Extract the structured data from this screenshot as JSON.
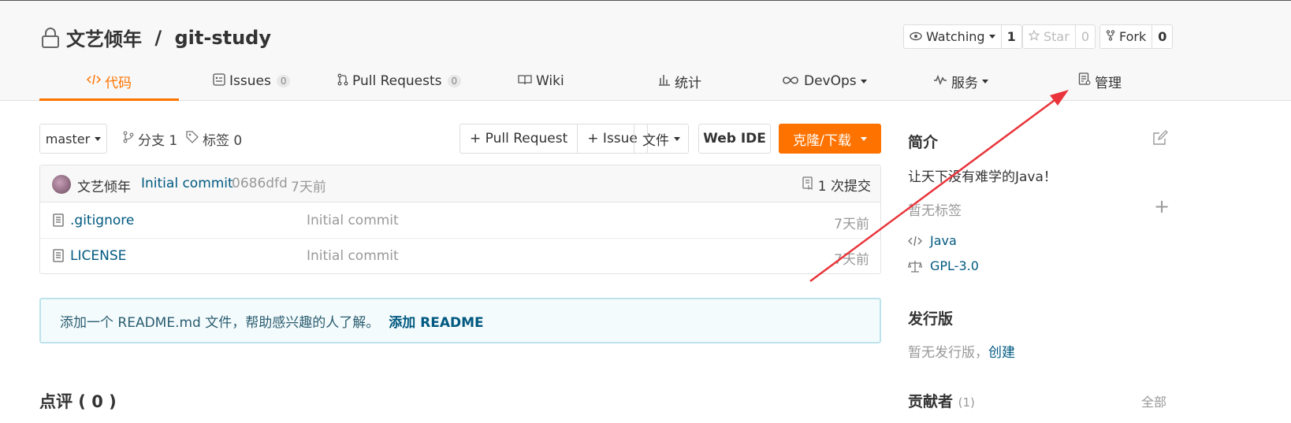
{
  "repo": {
    "owner": "文艺倾年",
    "separator": " / ",
    "name": "git-study"
  },
  "header_actions": {
    "watching": {
      "label": "Watching",
      "count": "1"
    },
    "star": {
      "label": "Star",
      "count": "0"
    },
    "fork": {
      "label": "Fork",
      "count": "0"
    }
  },
  "tabs": [
    {
      "label": "代码",
      "active": true
    },
    {
      "label": "Issues",
      "badge": "0"
    },
    {
      "label": "Pull Requests",
      "badge": "0"
    },
    {
      "label": "Wiki"
    },
    {
      "label": "统计"
    },
    {
      "label": "DevOps"
    },
    {
      "label": "服务"
    },
    {
      "label": "管理"
    }
  ],
  "toolbar": {
    "branch": "master",
    "branches": "分支 1",
    "tags": "标签 0",
    "pull_request": "+ Pull Request",
    "issue": "+ Issue",
    "files": "文件",
    "web_ide": "Web IDE",
    "clone": "克隆/下载"
  },
  "latest_commit": {
    "author": "文艺倾年",
    "message": "Initial commit",
    "hash": "0686dfd",
    "time": "7天前",
    "commit_count": "1 次提交"
  },
  "files": [
    {
      "name": ".gitignore",
      "message": "Initial commit",
      "time": "7天前"
    },
    {
      "name": "LICENSE",
      "message": "Initial commit",
      "time": "7天前"
    }
  ],
  "readme_banner": {
    "text": "添加一个 README.md 文件，帮助感兴趣的人了解。",
    "link": "添加 README"
  },
  "comments": {
    "title": "点评 ( 0 )"
  },
  "sidebar": {
    "intro_title": "简介",
    "description": "让天下没有难学的Java！",
    "no_tags": "暂无标签",
    "language": "Java",
    "license": "GPL-3.0",
    "releases_title": "发行版",
    "no_releases": "暂无发行版，",
    "create_link": "创建",
    "contributors_title": "贡献者",
    "contributors_count": "(1)",
    "all_link": "全部"
  },
  "colors": {
    "accent": "#fe7300",
    "link": "#005980",
    "annotation_arrow": "#e8343a"
  }
}
